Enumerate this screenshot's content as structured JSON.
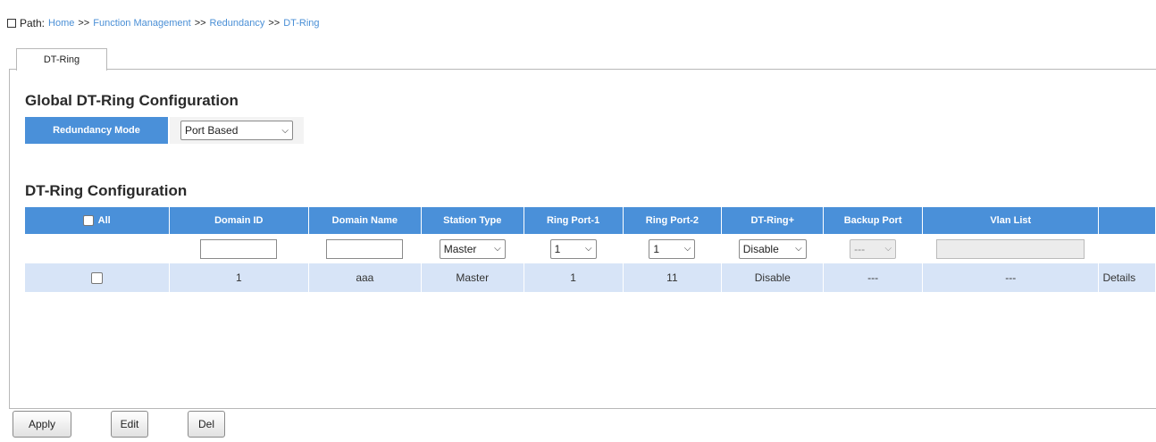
{
  "path": {
    "label": "Path:",
    "crumbs": [
      "Home",
      "Function Management",
      "Redundancy",
      "DT-Ring"
    ],
    "separator": ">>"
  },
  "tabs": [
    {
      "label": "DT-Ring",
      "active": true
    }
  ],
  "global": {
    "title": "Global DT-Ring Configuration",
    "mode_label": "Redundancy Mode",
    "mode_value": "Port Based"
  },
  "config": {
    "title": "DT-Ring Configuration",
    "columns": [
      "All",
      "Domain ID",
      "Domain Name",
      "Station Type",
      "Ring Port-1",
      "Ring Port-2",
      "DT-Ring+",
      "Backup Port",
      "Vlan List",
      ""
    ],
    "input_row": {
      "domain_id": "",
      "domain_name": "",
      "station_type": "Master",
      "ring_port_1": "1",
      "ring_port_2": "1",
      "dt_ring_plus": "Disable",
      "backup_port": "---",
      "vlan_list": ""
    },
    "rows": [
      {
        "checked": false,
        "domain_id": "1",
        "domain_name": "aaa",
        "station_type": "Master",
        "ring_port_1": "1",
        "ring_port_2": "11",
        "dt_ring_plus": "Disable",
        "backup_port": "---",
        "vlan_list": "---",
        "action": "Details"
      }
    ]
  },
  "buttons": {
    "apply": "Apply",
    "edit": "Edit",
    "del": "Del"
  },
  "colors": {
    "header_bg": "#4a90d9",
    "row_bg": "#d7e4f7",
    "link": "#4a8fd6"
  }
}
